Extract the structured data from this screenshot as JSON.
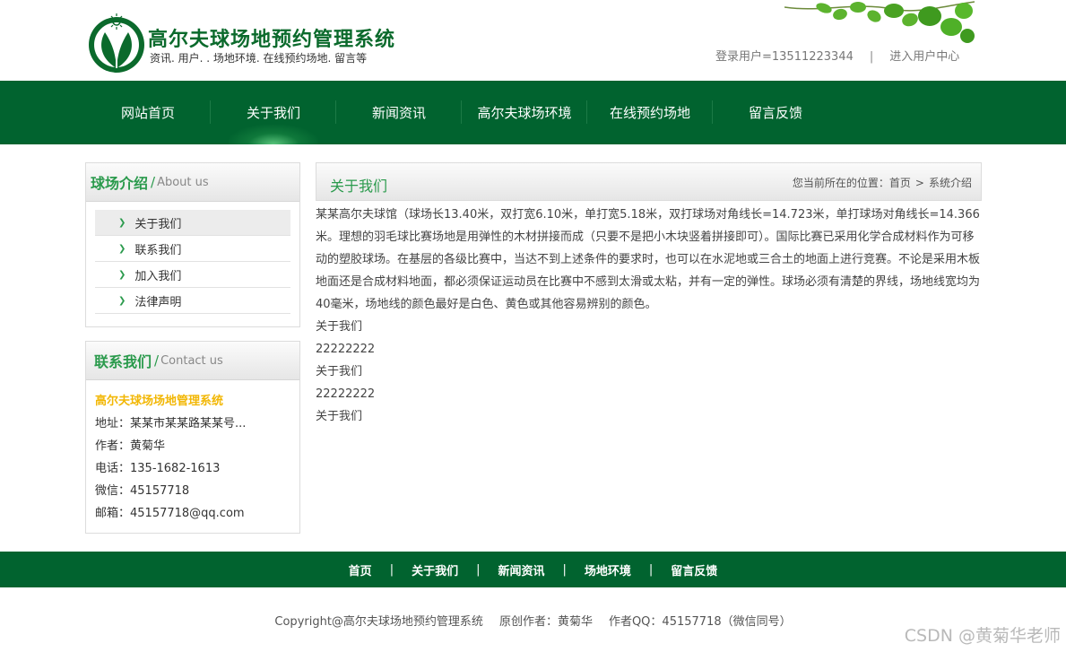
{
  "header": {
    "site_title": "高尔夫球场地预约管理系统",
    "slogan": "资讯. 用户. . 场地环境. 在线预约场地. 留言等",
    "login_user": "登录用户=13511223344",
    "separator": "|",
    "user_center": "进入用户中心"
  },
  "nav": {
    "items": [
      "网站首页",
      "关于我们",
      "新闻资讯",
      "高尔夫球场环境",
      "在线预约场地",
      "留言反馈"
    ],
    "active_index": 1
  },
  "sidebar": {
    "about": {
      "title_zh": "球场介绍",
      "title_en": "About us",
      "items": [
        "关于我们",
        "联系我们",
        "加入我们",
        "法律声明"
      ]
    },
    "contact": {
      "title_zh": "联系我们",
      "title_en": "Contact us",
      "name": "高尔夫球场场地管理系统",
      "address": "地址：某某市某某路某某号...",
      "author": "作者：黄菊华",
      "phone": "电话：135-1682-1613",
      "wechat": "微信：45157718",
      "email": "邮箱：45157718@qq.com"
    }
  },
  "main": {
    "title": "关于我们",
    "breadcrumb": {
      "prefix": "您当前所在的位置：",
      "home": "首页",
      "sep": ">",
      "current": "系统介绍"
    },
    "paragraph": "某某高尔夫球馆（球场长13.40米，双打宽6.10米，单打宽5.18米，双打球场对角线长=14.723米，单打球场对角线长=14.366米。理想的羽毛球比赛场地是用弹性的木材拼接而成（只要不是把小木块竖着拼接即可）。国际比赛已采用化学合成材料作为可移动的塑胶球场。在基层的各级比赛中，当达不到上述条件的要求时，也可以在水泥地或三合土的地面上进行竞赛。不论是采用木板地面还是合成材料地面，都必须保证运动员在比赛中不感到太滑或太粘，并有一定的弹性。球场必须有清楚的界线，场地线宽均为40毫米，场地线的颜色最好是白色、黄色或其他容易辨别的颜色。",
    "lines": [
      "关于我们",
      "22222222",
      "关于我们",
      "22222222",
      "关于我们"
    ]
  },
  "footer": {
    "nav": [
      "首页",
      "关于我们",
      "新闻资讯",
      "场地环境",
      "留言反馈"
    ],
    "separator": "|",
    "copyright": "Copyright@高尔夫球场地预约管理系统",
    "author": "原创作者：黄菊华",
    "qq": "作者QQ：45157718（微信同号）"
  },
  "watermark": "CSDN @黄菊华老师",
  "colors": {
    "brand_green": "#01632f",
    "accent_green": "#2a9a4c",
    "highlight_yellow": "#f2b705"
  }
}
